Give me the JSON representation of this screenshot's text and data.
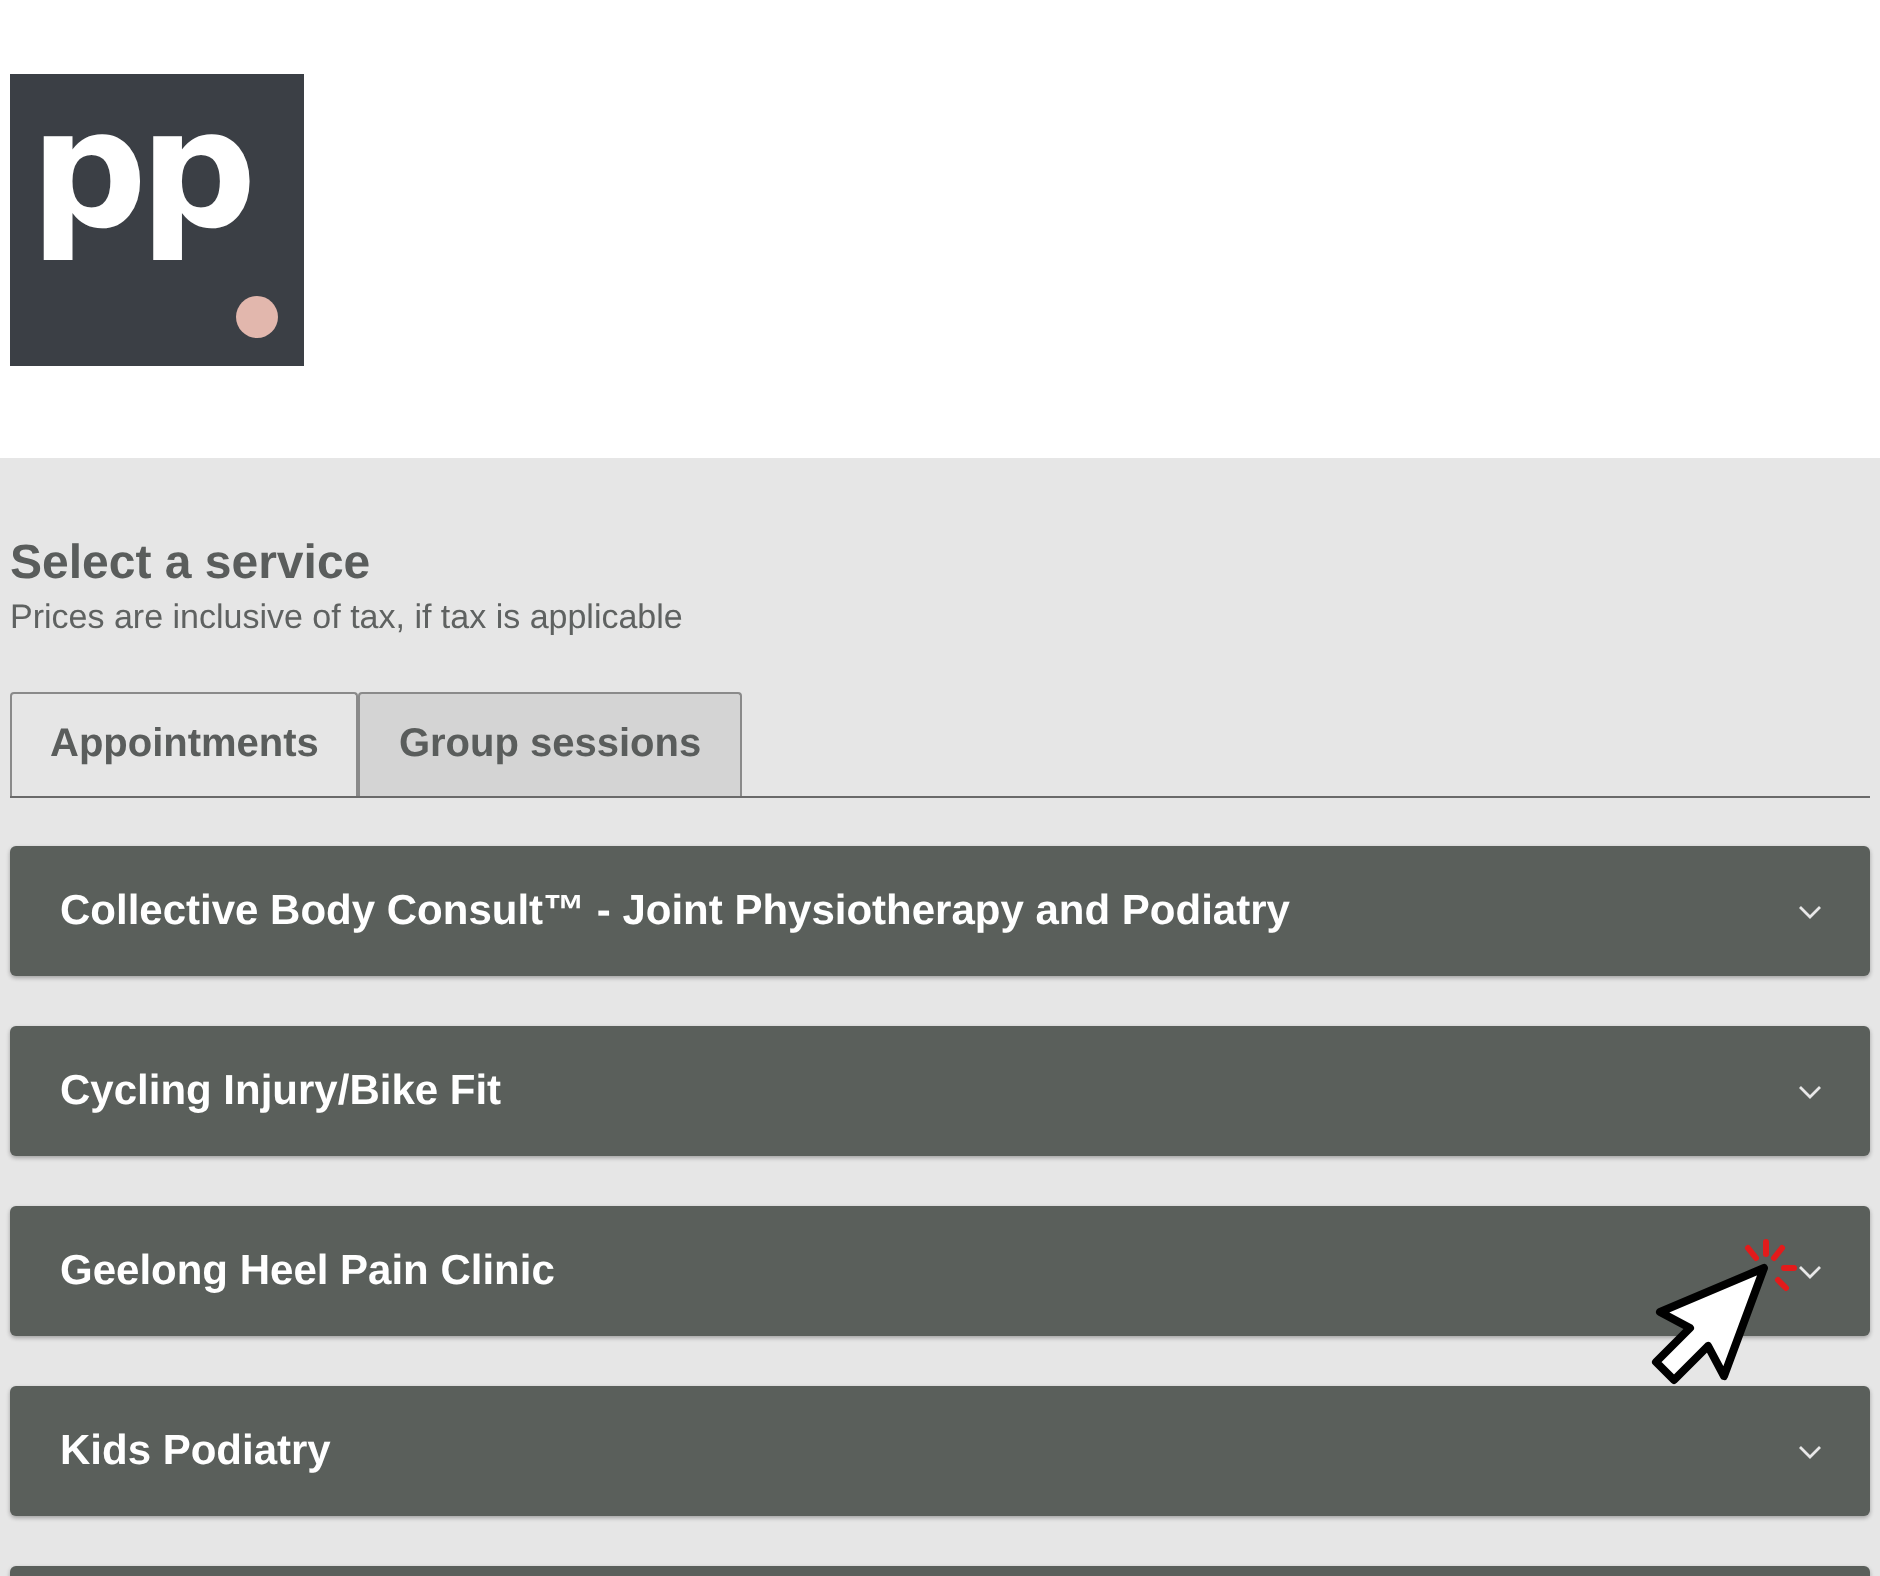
{
  "logo": {
    "text": "pp"
  },
  "heading": {
    "title": "Select a service",
    "subtitle": "Prices are inclusive of tax, if tax is applicable"
  },
  "tabs": [
    {
      "label": "Appointments",
      "selected": true
    },
    {
      "label": "Group sessions",
      "selected": false
    }
  ],
  "services": [
    {
      "kind": "full",
      "title": "Collective Body Consult™ - Joint Physiotherapy and Podiatry",
      "expanded": false
    },
    {
      "kind": "full",
      "title": "Cycling Injury/Bike Fit",
      "expanded": false
    },
    {
      "kind": "full",
      "title": "Geelong Heel Pain Clinic",
      "expanded": false
    },
    {
      "kind": "full",
      "title": "Kids Podiatry",
      "expanded": false
    },
    {
      "kind": "cut_off"
    }
  ]
}
